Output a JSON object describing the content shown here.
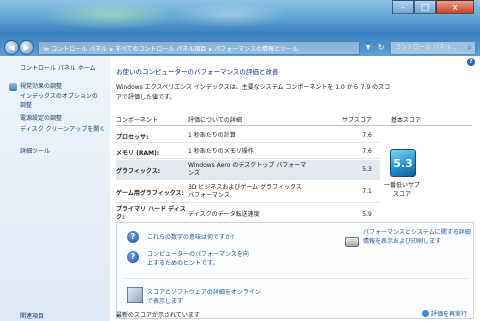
{
  "window": {
    "minimize_glyph": "–",
    "maximize_glyph": "□",
    "close_glyph": "x"
  },
  "address": {
    "crumbs": [
      "≫ コントロール パネル",
      "▸ すべてのコントロール パネル項目",
      "▸ パフォーマンスの情報とツール"
    ],
    "search_placeholder": "コントロール パネル..."
  },
  "sidebar": {
    "home": "コントロール パネル ホーム",
    "links": [
      "視覚効果の調整",
      "インデックスのオプションの調整",
      "電源設定の調整",
      "ディスク クリーンアップを開く",
      "詳細ツール"
    ],
    "bottom": "関連項目"
  },
  "main": {
    "title": "お使いのコンピューターのパフォーマンスの評価と改善",
    "description": "Windows エクスペリエンス インデックスは、主要なシステム コンポーネントを 1.0 から 7.9 のスコアで評価した値です。",
    "table": {
      "headers": {
        "component": "コンポーネント",
        "rating": "評価についての詳細",
        "subscore": "サブスコア",
        "basescore": "基本スコア"
      },
      "rows": [
        {
          "component": "プロセッサ:",
          "rating": "1 秒あたりの計算",
          "subscore": "7.6"
        },
        {
          "component": "メモリ (RAM):",
          "rating": "1 秒あたりのメモリ操作",
          "subscore": "7.6"
        },
        {
          "component": "グラフィックス:",
          "rating": "Windows Aero のデスクトップ パフォーマンス",
          "subscore": "5.3"
        },
        {
          "component": "ゲーム用グラフィックス:",
          "rating": "3D ビジネスおよびゲーム グラフィックス パフォーマンス",
          "subscore": "7.1"
        },
        {
          "component": "プライマリ ハード ディスク:",
          "rating": "ディスクのデータ転送速度",
          "subscore": "5.9"
        }
      ],
      "base_score": "5.3",
      "base_score_label": "一番低いサブスコア"
    },
    "info": {
      "q1": "これらの数字の意味は何ですか?",
      "q2": "コンピューターのパフォーマンスを向上するためのヒントです。",
      "print_link": "パフォーマンスとシステムに関する詳細情報を表示および印刷します",
      "online_link": "スコアとソフトウェアの詳細をオンラインで表示します"
    },
    "last_updated": "最新のスコアが示されています",
    "rerun": "評価を再実行"
  }
}
